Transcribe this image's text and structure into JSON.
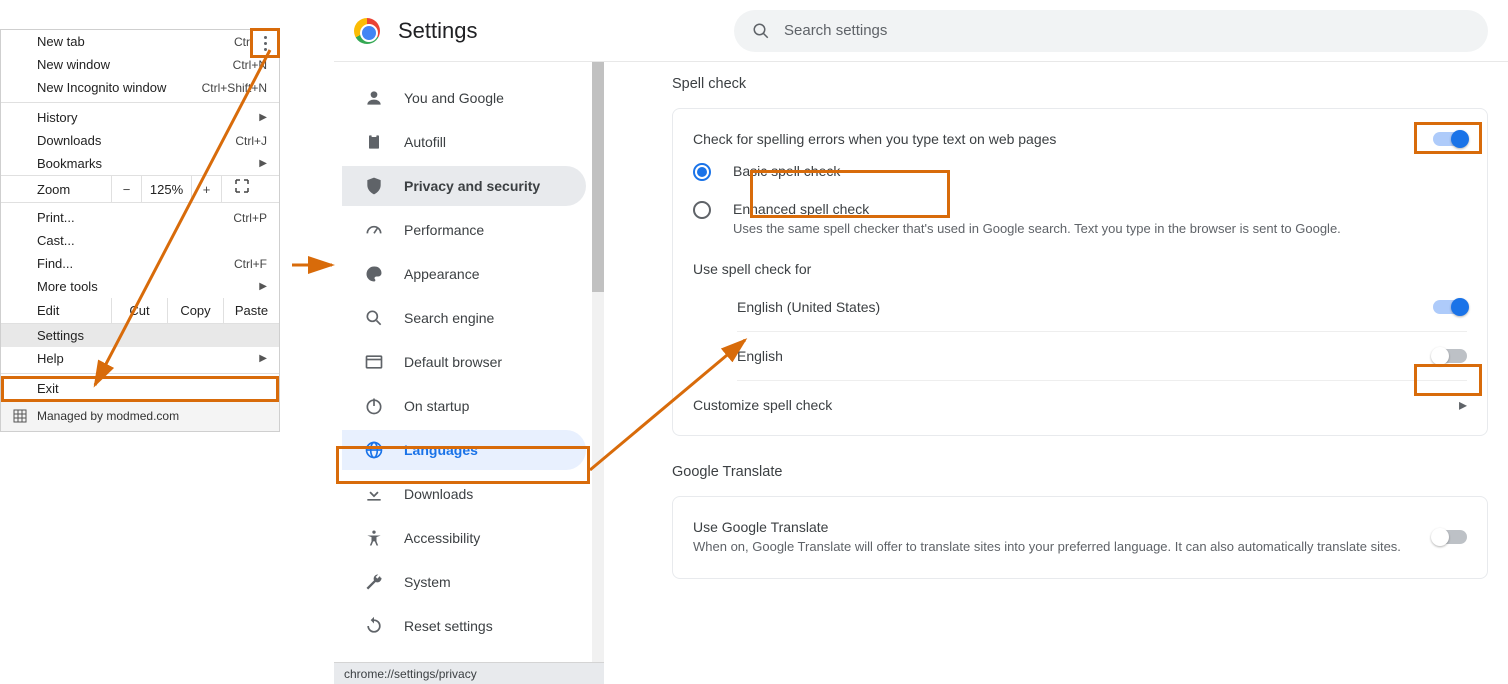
{
  "menu": {
    "newTab": "New tab",
    "newTabKey": "Ctrl+T",
    "newWindow": "New window",
    "newWindowKey": "Ctrl+N",
    "newIncognito": "New Incognito window",
    "newIncognitoKey": "Ctrl+Shift+N",
    "history": "History",
    "downloads": "Downloads",
    "downloadsKey": "Ctrl+J",
    "bookmarks": "Bookmarks",
    "zoomLabel": "Zoom",
    "zoomMinus": "−",
    "zoomVal": "125%",
    "zoomPlus": "+",
    "print": "Print...",
    "printKey": "Ctrl+P",
    "cast": "Cast...",
    "find": "Find...",
    "findKey": "Ctrl+F",
    "moreTools": "More tools",
    "edit": "Edit",
    "cut": "Cut",
    "copy": "Copy",
    "paste": "Paste",
    "settings": "Settings",
    "help": "Help",
    "exit": "Exit",
    "managed": "Managed by modmed.com"
  },
  "app": {
    "title": "Settings",
    "searchPlaceholder": "Search settings",
    "statusBar": "chrome://settings/privacy"
  },
  "sidebar": {
    "you": "You and Google",
    "autofill": "Autofill",
    "privacy": "Privacy and security",
    "performance": "Performance",
    "appearance": "Appearance",
    "search": "Search engine",
    "default": "Default browser",
    "startup": "On startup",
    "languages": "Languages",
    "downloads": "Downloads",
    "accessibility": "Accessibility",
    "system": "System",
    "reset": "Reset settings"
  },
  "spell": {
    "heading": "Spell check",
    "toggleLabel": "Check for spelling errors when you type text on web pages",
    "basic": "Basic spell check",
    "enhanced": "Enhanced spell check",
    "enhancedSub": "Uses the same spell checker that's used in Google search. Text you type in the browser is sent to Google.",
    "useFor": "Use spell check for",
    "lang1": "English (United States)",
    "lang2": "English",
    "customize": "Customize spell check"
  },
  "translate": {
    "heading": "Google Translate",
    "title": "Use Google Translate",
    "sub": "When on, Google Translate will offer to translate sites into your preferred language. It can also automatically translate sites."
  }
}
